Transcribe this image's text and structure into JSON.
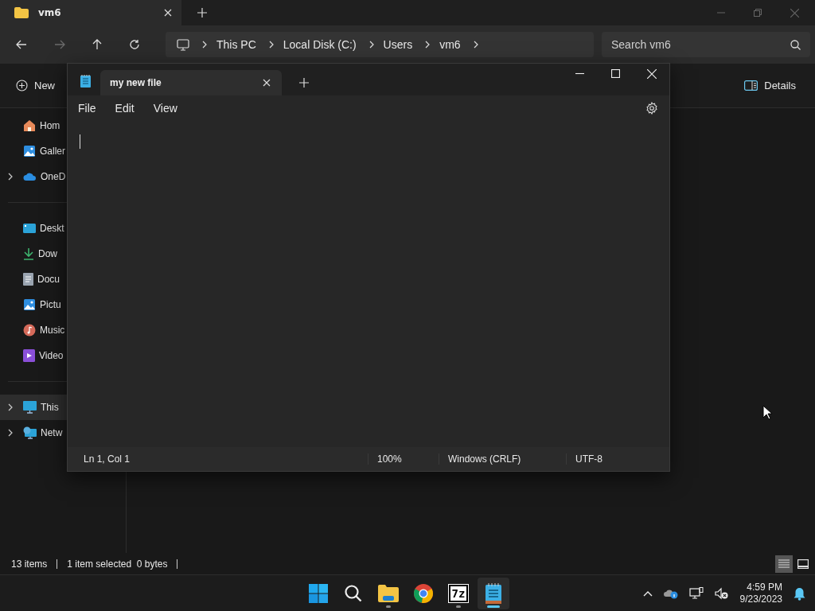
{
  "explorer": {
    "tabs": [
      {
        "label": "vm6",
        "selected": true
      }
    ],
    "nav": {
      "forward_disabled": true
    },
    "breadcrumb": [
      "This PC",
      "Local Disk (C:)",
      "Users",
      "vm6"
    ],
    "search": {
      "placeholder": "Search vm6"
    },
    "command_bar": {
      "new": "New",
      "details": "Details"
    },
    "sidebar": [
      {
        "label": "Hom",
        "expandable": false,
        "selected": false
      },
      {
        "label": "Galler",
        "expandable": false,
        "selected": false
      },
      {
        "label": "OneD",
        "expandable": true,
        "selected": false
      },
      {
        "label": "Deskt",
        "expandable": false,
        "selected": false
      },
      {
        "label": "Dow",
        "expandable": false,
        "selected": false
      },
      {
        "label": "Docu",
        "expandable": false,
        "selected": false
      },
      {
        "label": "Pictu",
        "expandable": false,
        "selected": false
      },
      {
        "label": "Music",
        "expandable": false,
        "selected": false
      },
      {
        "label": "Video",
        "expandable": false,
        "selected": false
      },
      {
        "label": "This",
        "expandable": true,
        "selected": true
      },
      {
        "label": "Netw",
        "expandable": true,
        "selected": false
      }
    ],
    "status_bar": [
      "13 items",
      "1 item selected  0 bytes"
    ],
    "view_toggles": [
      {
        "kind": "details",
        "selected": true
      },
      {
        "kind": "tiles",
        "selected": false
      }
    ]
  },
  "notepad": {
    "tabs": [
      {
        "label": "my new file",
        "selected": true
      }
    ],
    "menu": [
      "File",
      "Edit",
      "View"
    ],
    "status_bar": [
      "Ln 1, Col 1",
      "100%",
      "Windows (CRLF)",
      "UTF-8"
    ]
  },
  "taskbar": {
    "apps": [
      {
        "kind": "start",
        "running": false,
        "active": false
      },
      {
        "kind": "search",
        "running": false,
        "active": false
      },
      {
        "kind": "explorer",
        "running": true,
        "active": false
      },
      {
        "kind": "chrome",
        "running": false,
        "active": false
      },
      {
        "kind": "archiver",
        "label": "7z",
        "running": true,
        "active": false
      },
      {
        "kind": "notepad",
        "running": true,
        "active": true
      }
    ],
    "time": "4:59 PM",
    "date": "9/23/2023"
  }
}
